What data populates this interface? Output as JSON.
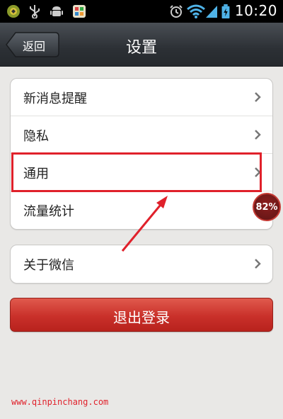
{
  "status_bar": {
    "time": "10:20"
  },
  "header": {
    "back_label": "返回",
    "title": "设置"
  },
  "groups": [
    {
      "items": [
        {
          "label": "新消息提醒"
        },
        {
          "label": "隐私"
        },
        {
          "label": "通用"
        },
        {
          "label": "流量统计"
        }
      ]
    },
    {
      "items": [
        {
          "label": "关于微信"
        }
      ]
    }
  ],
  "logout": {
    "label": "退出登录"
  },
  "overlay": {
    "badge": "82%",
    "watermark": "www.qinpinchang.com"
  },
  "colors": {
    "accent_red": "#c9302a",
    "annotation_red": "#e0212b",
    "title_bar": "#2c3035"
  }
}
